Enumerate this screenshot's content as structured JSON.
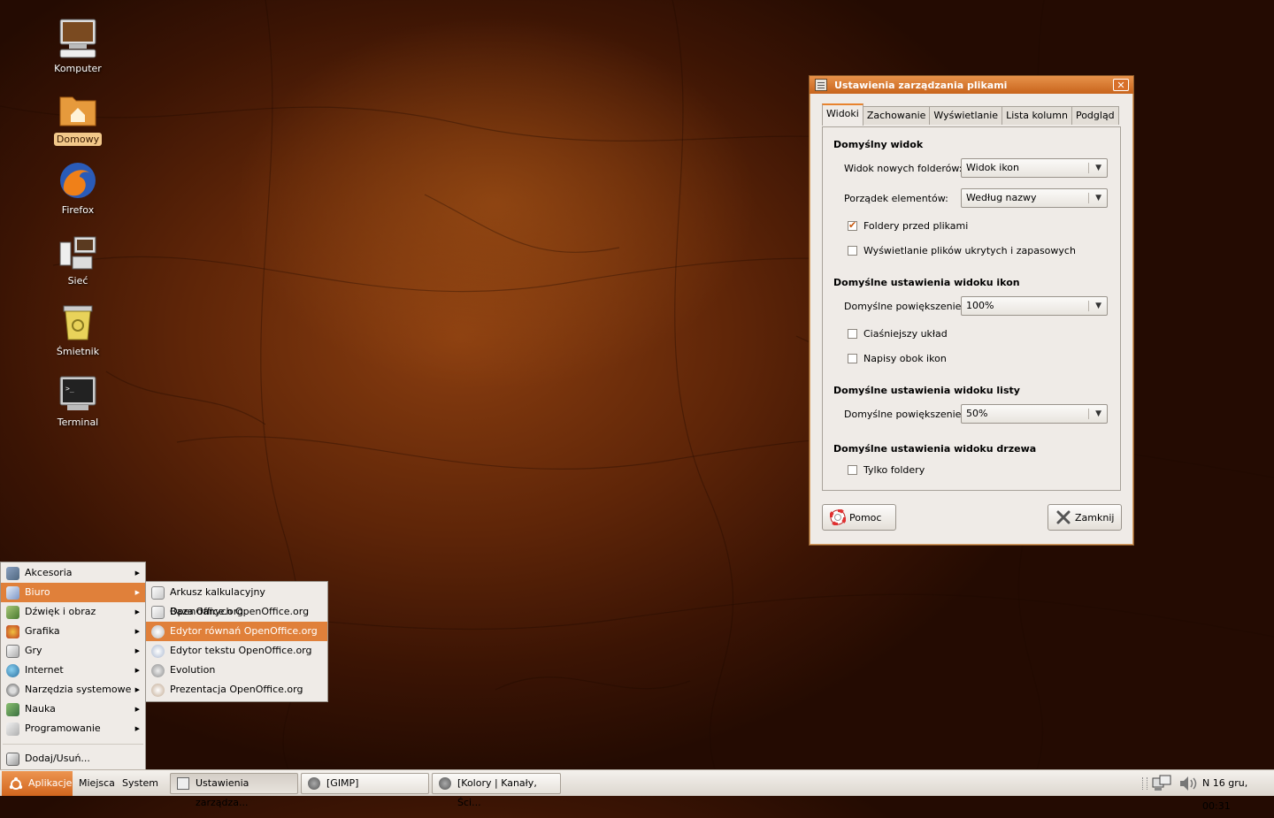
{
  "desktop": {
    "icons": [
      {
        "label": "Komputer",
        "icon": "computer-icon"
      },
      {
        "label": "Domowy",
        "icon": "home-folder-icon"
      },
      {
        "label": "Firefox",
        "icon": "firefox-icon"
      },
      {
        "label": "Sieć",
        "icon": "network-icon"
      },
      {
        "label": "Śmietnik",
        "icon": "trash-icon"
      },
      {
        "label": "Terminal",
        "icon": "terminal-icon"
      }
    ]
  },
  "dialog": {
    "title": "Ustawienia zarządzania plikami",
    "tabs": [
      "Widoki",
      "Zachowanie",
      "Wyświetlanie",
      "Lista kolumn",
      "Podgląd"
    ],
    "sections": {
      "default_view": "Domyślny widok",
      "icon_view": "Domyślne ustawienia widoku ikon",
      "list_view": "Domyślne ustawienia widoku listy",
      "tree_view": "Domyślne ustawienia widoku drzewa"
    },
    "new_folder_view_label": "Widok nowych folderów:",
    "new_folder_view_value": "Widok ikon",
    "arrange_label": "Porządek elementów:",
    "arrange_value": "Według nazwy",
    "folders_first_label": "Foldery przed plikami",
    "folders_first_checked": true,
    "show_hidden_label": "Wyświetlanie plików ukrytych i zapasowych",
    "show_hidden_checked": false,
    "icon_zoom_label": "Domyślne powiększenie:",
    "icon_zoom_value": "100%",
    "compact_label": "Ciaśniejszy układ",
    "compact_checked": false,
    "text_beside_label": "Napisy obok ikon",
    "text_beside_checked": false,
    "list_zoom_label": "Domyślne powiększenie:",
    "list_zoom_value": "50%",
    "folders_only_label": "Tylko foldery",
    "folders_only_checked": false,
    "help_button": "Pomoc",
    "close_button": "Zamknij"
  },
  "app_menu": {
    "items": [
      {
        "label": "Akcesoria",
        "icon": "accessories-icon",
        "submenu": true
      },
      {
        "label": "Biuro",
        "icon": "office-icon",
        "submenu": true,
        "highlighted": true
      },
      {
        "label": "Dźwięk i obraz",
        "icon": "multimedia-icon",
        "submenu": true
      },
      {
        "label": "Grafika",
        "icon": "graphics-icon",
        "submenu": true
      },
      {
        "label": "Gry",
        "icon": "games-icon",
        "submenu": true
      },
      {
        "label": "Internet",
        "icon": "internet-icon",
        "submenu": true
      },
      {
        "label": "Narzędzia systemowe",
        "icon": "system-tools-icon",
        "submenu": true
      },
      {
        "label": "Nauka",
        "icon": "science-icon",
        "submenu": true
      },
      {
        "label": "Programowanie",
        "icon": "development-icon",
        "submenu": true
      }
    ],
    "add_remove": "Dodaj/Usuń..."
  },
  "office_submenu": {
    "items": [
      {
        "label": "Arkusz kalkulacyjny OpenOffice.org",
        "icon": "spreadsheet-icon"
      },
      {
        "label": "Baza danych OpenOffice.org",
        "icon": "database-icon"
      },
      {
        "label": "Edytor równań OpenOffice.org",
        "icon": "math-icon",
        "highlighted": true
      },
      {
        "label": "Edytor tekstu OpenOffice.org",
        "icon": "writer-icon"
      },
      {
        "label": "Evolution",
        "icon": "evolution-icon"
      },
      {
        "label": "Prezentacja OpenOffice.org",
        "icon": "presentation-icon"
      }
    ]
  },
  "taskbar": {
    "applications": "Aplikacje",
    "places": "Miejsca",
    "system": "System",
    "tasks": [
      "Ustawienia zarządza...",
      "[GIMP]",
      "[Kolory | Kanały, Ści..."
    ],
    "clock": "N 16 gru, 00:31"
  }
}
